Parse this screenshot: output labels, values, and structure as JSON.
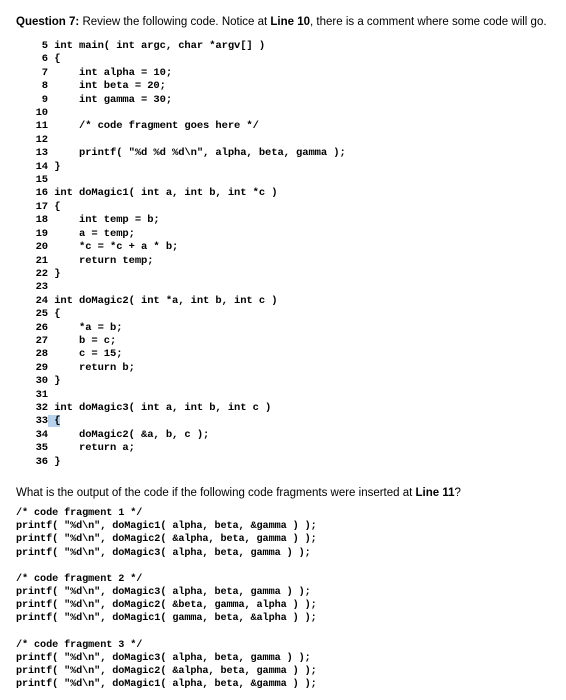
{
  "question": {
    "label": "Question 7:",
    "text_1": " Review the following code. Notice at ",
    "line_ref": "Line 10",
    "text_2": ", there is a comment where some code will go."
  },
  "code": {
    "lines": [
      {
        "num": "5",
        "text": "int main( int argc, char *argv[] )"
      },
      {
        "num": "6",
        "text": "{"
      },
      {
        "num": "7",
        "text": "    int alpha = 10;"
      },
      {
        "num": "8",
        "text": "    int beta = 20;"
      },
      {
        "num": "9",
        "text": "    int gamma = 30;"
      },
      {
        "num": "10",
        "text": ""
      },
      {
        "num": "11",
        "text": "    /* code fragment goes here */"
      },
      {
        "num": "12",
        "text": ""
      },
      {
        "num": "13",
        "text": "    printf( \"%d %d %d\\n\", alpha, beta, gamma );"
      },
      {
        "num": "14",
        "text": "}"
      },
      {
        "num": "15",
        "text": ""
      },
      {
        "num": "16",
        "text": "int doMagic1( int a, int b, int *c )"
      },
      {
        "num": "17",
        "text": "{"
      },
      {
        "num": "18",
        "text": "    int temp = b;"
      },
      {
        "num": "19",
        "text": "    a = temp;"
      },
      {
        "num": "20",
        "text": "    *c = *c + a * b;"
      },
      {
        "num": "21",
        "text": "    return temp;"
      },
      {
        "num": "22",
        "text": "}"
      },
      {
        "num": "23",
        "text": ""
      },
      {
        "num": "24",
        "text": "int doMagic2( int *a, int b, int c )"
      },
      {
        "num": "25",
        "text": "{"
      },
      {
        "num": "26",
        "text": "    *a = b;"
      },
      {
        "num": "27",
        "text": "    b = c;"
      },
      {
        "num": "28",
        "text": "    c = 15;"
      },
      {
        "num": "29",
        "text": "    return b;"
      },
      {
        "num": "30",
        "text": "}"
      },
      {
        "num": "31",
        "text": ""
      },
      {
        "num": "32",
        "text": "int doMagic3( int a, int b, int c )"
      },
      {
        "num": "33",
        "text": "{",
        "selected": true
      },
      {
        "num": "34",
        "text": "    doMagic2( &a, b, c );"
      },
      {
        "num": "35",
        "text": "    return a;"
      },
      {
        "num": "36",
        "text": "}"
      }
    ]
  },
  "mid_question": {
    "text_1": "What is the output of the code if the following code fragments were inserted at ",
    "line_ref": "Line 11",
    "text_2": "?"
  },
  "fragments": [
    {
      "comment": "/* code fragment 1 */",
      "lines": [
        "printf( \"%d\\n\", doMagic1( alpha, beta, &gamma ) );",
        "printf( \"%d\\n\", doMagic2( &alpha, beta, gamma ) );",
        "printf( \"%d\\n\", doMagic3( alpha, beta, gamma ) );"
      ]
    },
    {
      "comment": "/* code fragment 2 */",
      "lines": [
        "printf( \"%d\\n\", doMagic3( alpha, beta, gamma ) );",
        "printf( \"%d\\n\", doMagic2( &beta, gamma, alpha ) );",
        "printf( \"%d\\n\", doMagic1( gamma, beta, &alpha ) );"
      ]
    },
    {
      "comment": "/* code fragment 3 */",
      "lines": [
        "printf( \"%d\\n\", doMagic3( alpha, beta, gamma ) );",
        "printf( \"%d\\n\", doMagic2( &alpha, beta, gamma ) );",
        "printf( \"%d\\n\", doMagic1( alpha, beta, &gamma ) );"
      ]
    }
  ]
}
